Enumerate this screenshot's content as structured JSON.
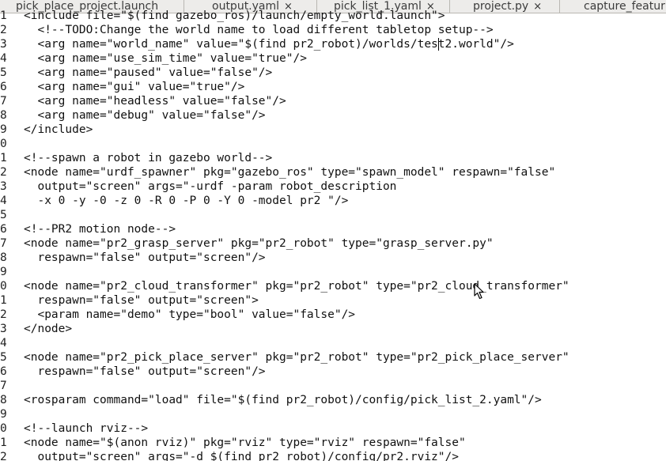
{
  "tabs": [
    {
      "label": "pick_place_project.launch",
      "close": ""
    },
    {
      "label": "output.yaml",
      "close": "×"
    },
    {
      "label": "pick_list_1.yaml",
      "close": "×"
    },
    {
      "label": "project.py",
      "close": "×"
    },
    {
      "label": "capture_featur",
      "close": ""
    }
  ],
  "lines": [
    {
      "n": "1",
      "code": "<include file=\"$(find gazebo_ros)/launch/empty_world.launch\">"
    },
    {
      "n": "2",
      "code": "  <!--TODO:Change the world name to load different tabletop setup-->"
    },
    {
      "n": "3",
      "code": "  <arg name=\"world_name\" value=\"$(find pr2_robot)/worlds/test2.world\"/>"
    },
    {
      "n": "4",
      "code": "  <arg name=\"use_sim_time\" value=\"true\"/>"
    },
    {
      "n": "5",
      "code": "  <arg name=\"paused\" value=\"false\"/>"
    },
    {
      "n": "6",
      "code": "  <arg name=\"gui\" value=\"true\"/>"
    },
    {
      "n": "7",
      "code": "  <arg name=\"headless\" value=\"false\"/>"
    },
    {
      "n": "8",
      "code": "  <arg name=\"debug\" value=\"false\"/>"
    },
    {
      "n": "9",
      "code": "</include>"
    },
    {
      "n": "0",
      "code": ""
    },
    {
      "n": "1",
      "code": "<!--spawn a robot in gazebo world-->"
    },
    {
      "n": "2",
      "code": "<node name=\"urdf_spawner\" pkg=\"gazebo_ros\" type=\"spawn_model\" respawn=\"false\""
    },
    {
      "n": "3",
      "code": "  output=\"screen\" args=\"-urdf -param robot_description"
    },
    {
      "n": "4",
      "code": "  -x 0 -y -0 -z 0 -R 0 -P 0 -Y 0 -model pr2 \"/>"
    },
    {
      "n": "5",
      "code": ""
    },
    {
      "n": "6",
      "code": "<!--PR2 motion node-->"
    },
    {
      "n": "7",
      "code": "<node name=\"pr2_grasp_server\" pkg=\"pr2_robot\" type=\"grasp_server.py\""
    },
    {
      "n": "8",
      "code": "  respawn=\"false\" output=\"screen\"/>"
    },
    {
      "n": "9",
      "code": ""
    },
    {
      "n": "0",
      "code": "<node name=\"pr2_cloud_transformer\" pkg=\"pr2_robot\" type=\"pr2_cloud_transformer\""
    },
    {
      "n": "1",
      "code": "  respawn=\"false\" output=\"screen\">"
    },
    {
      "n": "2",
      "code": "  <param name=\"demo\" type=\"bool\" value=\"false\"/>"
    },
    {
      "n": "3",
      "code": "</node>"
    },
    {
      "n": "4",
      "code": ""
    },
    {
      "n": "5",
      "code": "<node name=\"pr2_pick_place_server\" pkg=\"pr2_robot\" type=\"pr2_pick_place_server\""
    },
    {
      "n": "6",
      "code": "  respawn=\"false\" output=\"screen\"/>"
    },
    {
      "n": "7",
      "code": ""
    },
    {
      "n": "8",
      "code": "<rosparam command=\"load\" file=\"$(find pr2_robot)/config/pick_list_2.yaml\"/>"
    },
    {
      "n": "9",
      "code": ""
    },
    {
      "n": "0",
      "code": "<!--launch rviz-->"
    },
    {
      "n": "1",
      "code": "<node name=\"$(anon rviz)\" pkg=\"rviz\" type=\"rviz\" respawn=\"false\""
    },
    {
      "n": "2",
      "code": "  output=\"screen\" args=\"-d $(find pr2_robot)/config/pr2.rviz\"/>"
    }
  ],
  "cursor": {
    "line_index": 2,
    "column": 60
  }
}
